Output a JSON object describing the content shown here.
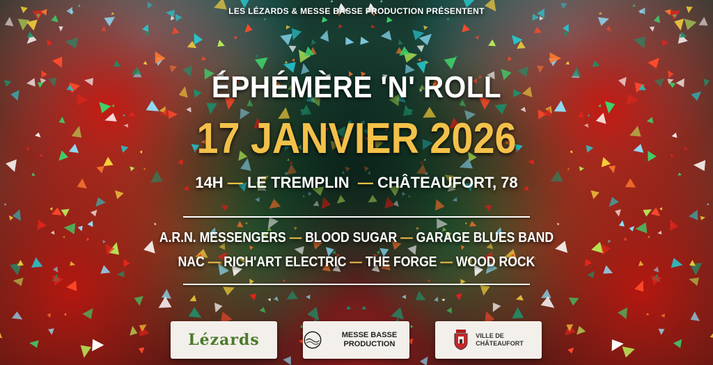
{
  "presenters": "LES LÉZARDS & MESSE BASSE PRODUCTION PRÉSENTENT",
  "event_title": "ÉPHÉMÈRE 'N' ROLL",
  "event_date": "17 JANVIER 2026",
  "event_info": {
    "time": "14H",
    "venue": "LE TREMPLIN",
    "city": "CHÂTEAUFORT, 78",
    "separator": "—"
  },
  "lineup": {
    "row1": [
      "A.R.N. MESSENGERS",
      "BLOOD SUGAR",
      "GARAGE BLUES BAND"
    ],
    "row2": [
      "NAC",
      "RICH'ART ELECTRIC",
      "THE FORGE",
      "WOOD ROCK"
    ]
  },
  "logos": {
    "lezards": "Lézards",
    "messe_basse": "MESSE BASSE PRODUCTION",
    "ville_line1": "VILLE DE",
    "ville_line2": "CHÂTEAUFORT"
  },
  "colors": {
    "accent": "#f3c14a",
    "text": "#ffffff",
    "card": "#f3efea"
  }
}
